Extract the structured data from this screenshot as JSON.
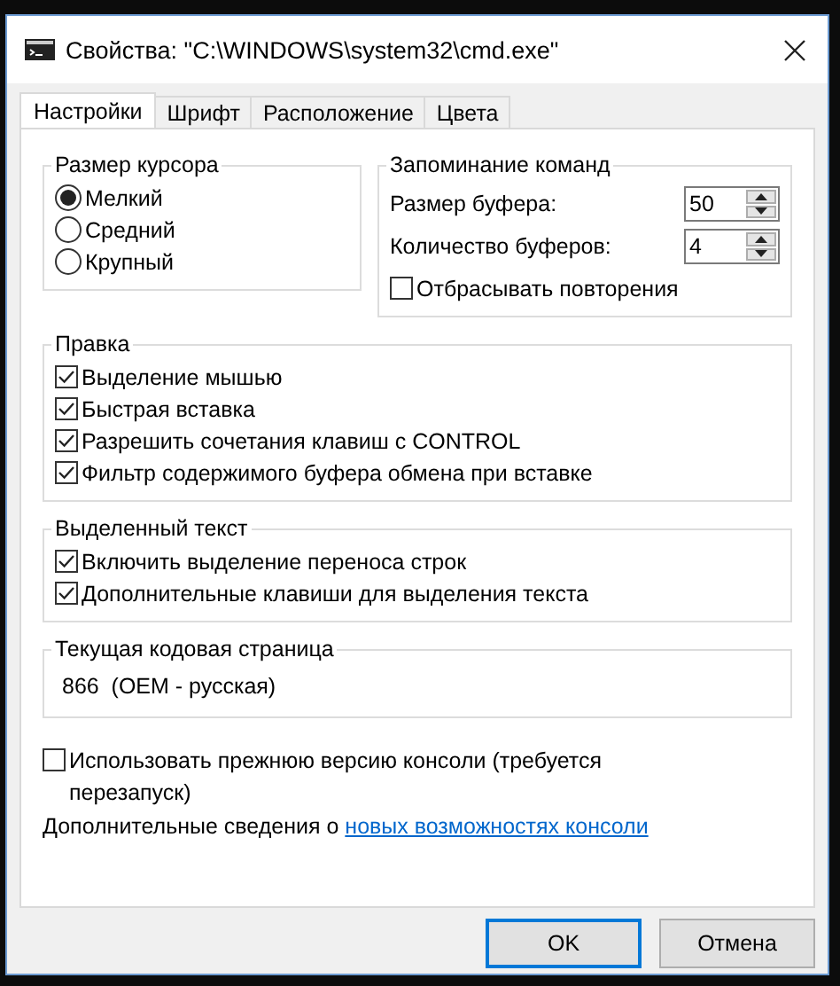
{
  "window": {
    "title": "Свойства: \"C:\\WINDOWS\\system32\\cmd.exe\""
  },
  "tabs": [
    {
      "label": "Настройки",
      "selected": true
    },
    {
      "label": "Шрифт",
      "selected": false
    },
    {
      "label": "Расположение",
      "selected": false
    },
    {
      "label": "Цвета",
      "selected": false
    }
  ],
  "cursor_size": {
    "title": "Размер курсора",
    "options": [
      {
        "label": "Мелкий",
        "selected": true
      },
      {
        "label": "Средний",
        "selected": false
      },
      {
        "label": "Крупный",
        "selected": false
      }
    ]
  },
  "command_history": {
    "title": "Запоминание команд",
    "fields": [
      {
        "label": "Размер буфера:",
        "value": "50"
      },
      {
        "label": "Количество буферов:",
        "value": "4"
      }
    ],
    "discard_duplicates": {
      "label": "Отбрасывать повторения",
      "checked": false
    }
  },
  "edit_options": {
    "title": "Правка",
    "items": [
      {
        "label": "Выделение мышью",
        "checked": true
      },
      {
        "label": "Быстрая вставка",
        "checked": true
      },
      {
        "label": "Разрешить сочетания клавиш с CONTROL",
        "checked": true
      },
      {
        "label": "Фильтр содержимого буфера обмена при вставке",
        "checked": true
      }
    ]
  },
  "text_selection": {
    "title": "Выделенный текст",
    "items": [
      {
        "label": "Включить выделение переноса строк",
        "checked": true
      },
      {
        "label": "Дополнительные клавиши для выделения текста",
        "checked": true
      }
    ]
  },
  "code_page": {
    "title": "Текущая кодовая страница",
    "value": "866  (OEM - русская)"
  },
  "legacy_console": {
    "label": "Использовать прежнюю версию консоли (требуется перезапуск)",
    "checked": false
  },
  "more_info": {
    "text": "Дополнительные сведения о",
    "link": "новых возможностях консоли"
  },
  "buttons": [
    {
      "label": "OK",
      "default": true
    },
    {
      "label": "Отмена",
      "default": false
    }
  ]
}
